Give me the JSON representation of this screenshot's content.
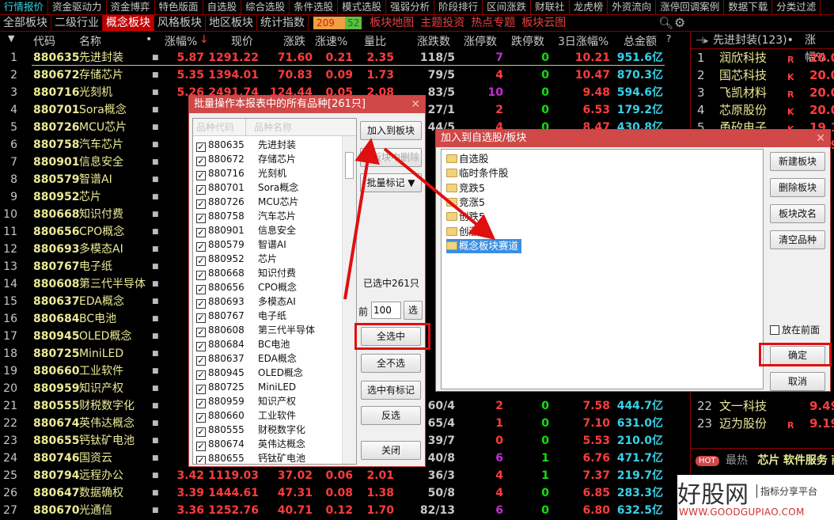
{
  "menu": [
    "行情报价",
    "资金驱动力",
    "资金博弈",
    "特色版面",
    "自选股",
    "综合选股",
    "条件选股",
    "模式选股",
    "强弱分析",
    "阶段排行",
    "区间涨跌",
    "财联社",
    "龙虎榜",
    "外资流向",
    "涨停回调案例",
    "数据下载",
    "分类过滤"
  ],
  "tabs": [
    "全部板块",
    "二级行业",
    "概念板块",
    "风格板块",
    "地区板块",
    "统计指数"
  ],
  "active_tab": "概念板块",
  "counts": {
    "up": "209",
    "down": "52"
  },
  "links": [
    "板块地图",
    "主题投资",
    "热点专题",
    "板块云图"
  ],
  "headers": {
    "arrow": "▼",
    "code": "代码",
    "name": "名称",
    "dot": "•",
    "pct": "涨幅%",
    "sort": "↓",
    "price": "现价",
    "chg": "涨跌",
    "speed": "涨速%",
    "vol": "量比",
    "updown": "涨跌数",
    "limitup": "涨停数",
    "limitdown": "跌停数",
    "pct3": "3日涨幅%",
    "amount": "总金额",
    "q": "?"
  },
  "rows": [
    [
      "1",
      "880635",
      "先进封装",
      "5.87",
      "1291.22",
      "71.60",
      "0.21",
      "2.35",
      "118/5",
      "7",
      "0",
      "10.21",
      "951.6亿"
    ],
    [
      "2",
      "880672",
      "存储芯片",
      "5.35",
      "1394.01",
      "70.83",
      "0.09",
      "1.73",
      "79/5",
      "4",
      "0",
      "10.47",
      "870.3亿"
    ],
    [
      "3",
      "880716",
      "光刻机",
      "5.26",
      "2491.74",
      "124.44",
      "0.05",
      "2.08",
      "83/5",
      "10",
      "0",
      "9.48",
      "594.6亿"
    ],
    [
      "4",
      "880701",
      "Sora概念",
      "",
      "",
      "",
      "",
      "",
      "27/1",
      "2",
      "0",
      "6.53",
      "179.2亿"
    ],
    [
      "5",
      "880726",
      "MCU芯片",
      "",
      "",
      "",
      "",
      "",
      "44/5",
      "4",
      "0",
      "8.47",
      "430.8亿"
    ],
    [
      "6",
      "880758",
      "汽车芯片",
      "",
      "",
      "",
      "",
      "",
      "",
      "",
      "",
      "",
      ""
    ],
    [
      "7",
      "880901",
      "信息安全",
      "",
      "",
      "",
      "",
      "",
      "",
      "",
      "",
      "",
      ""
    ],
    [
      "8",
      "880579",
      "智谱AI",
      "",
      "",
      "",
      "",
      "",
      "",
      "",
      "",
      "",
      ""
    ],
    [
      "9",
      "880952",
      "芯片",
      "",
      "",
      "",
      "",
      "",
      "",
      "",
      "",
      "",
      ""
    ],
    [
      "10",
      "880668",
      "知识付费",
      "",
      "",
      "",
      "",
      "",
      "",
      "",
      "",
      "",
      ""
    ],
    [
      "11",
      "880656",
      "CPO概念",
      "",
      "",
      "",
      "",
      "",
      "",
      "",
      "",
      "",
      ""
    ],
    [
      "12",
      "880693",
      "多模态AI",
      "",
      "",
      "",
      "",
      "",
      "",
      "",
      "",
      "",
      ""
    ],
    [
      "13",
      "880767",
      "电子纸",
      "",
      "",
      "",
      "",
      "",
      "",
      "",
      "",
      "",
      ""
    ],
    [
      "14",
      "880608",
      "第三代半导体",
      "",
      "",
      "",
      "",
      "",
      "",
      "",
      "",
      "",
      ""
    ],
    [
      "15",
      "880637",
      "EDA概念",
      "",
      "",
      "",
      "",
      "",
      "",
      "",
      "",
      "",
      ""
    ],
    [
      "16",
      "880684",
      "BC电池",
      "",
      "",
      "",
      "",
      "",
      "",
      "",
      "",
      "",
      ""
    ],
    [
      "17",
      "880945",
      "OLED概念",
      "",
      "",
      "",
      "",
      "",
      "",
      "",
      "",
      "",
      ""
    ],
    [
      "18",
      "880725",
      "MiniLED",
      "",
      "",
      "",
      "",
      "",
      "",
      "",
      "",
      "",
      ""
    ],
    [
      "19",
      "880660",
      "工业软件",
      "",
      "",
      "",
      "",
      "",
      "",
      "",
      "",
      "",
      ""
    ],
    [
      "20",
      "880959",
      "知识产权",
      "",
      "",
      "",
      "",
      "",
      "",
      "",
      "",
      "",
      ""
    ],
    [
      "21",
      "880555",
      "财税数字化",
      "",
      "",
      "",
      "",
      "",
      "60/4",
      "2",
      "0",
      "7.58",
      "444.7亿"
    ],
    [
      "22",
      "880674",
      "英伟达概念",
      "",
      "",
      "",
      "",
      "",
      "65/4",
      "1",
      "0",
      "7.10",
      "631.0亿"
    ],
    [
      "23",
      "880655",
      "钙钛矿电池",
      "",
      "",
      "",
      "",
      "",
      "39/7",
      "0",
      "0",
      "5.53",
      "210.0亿"
    ],
    [
      "24",
      "880746",
      "国资云",
      "",
      "",
      "",
      "",
      "",
      "40/8",
      "6",
      "1",
      "6.76",
      "471.7亿"
    ],
    [
      "25",
      "880794",
      "远程办公",
      "3.42",
      "1119.03",
      "37.02",
      "0.06",
      "2.01",
      "36/3",
      "4",
      "1",
      "7.37",
      "219.7亿"
    ],
    [
      "26",
      "880647",
      "数据确权",
      "3.39",
      "1444.61",
      "47.31",
      "0.08",
      "1.38",
      "50/8",
      "4",
      "0",
      "6.85",
      "283.3亿"
    ],
    [
      "27",
      "880670",
      "光通信",
      "3.36",
      "1252.76",
      "40.71",
      "0.12",
      "1.70",
      "82/13",
      "6",
      "0",
      "6.80",
      "632.5亿"
    ]
  ],
  "right_panel": {
    "title": "先进封装(123)•",
    "col": "涨幅%",
    "items": [
      [
        "1",
        "润欣科技",
        "R",
        "20.01"
      ],
      [
        "2",
        "国芯科技",
        "K",
        "20.01"
      ],
      [
        "3",
        "飞凯材料",
        "R",
        "20.00"
      ],
      [
        "4",
        "芯原股份",
        "K",
        "20.00"
      ],
      [
        "5",
        "甬矽电子",
        "K",
        "19.12"
      ],
      [
        "6",
        "晶圆斯特",
        "",
        "18.97"
      ]
    ],
    "items_bottom": [
      [
        "22",
        "文一科技",
        "",
        "9.49"
      ],
      [
        "23",
        "迈为股份",
        "R",
        "9.19"
      ]
    ],
    "hot": {
      "badge": "HOT",
      "label": "最热",
      "tags": [
        "芯片",
        "软件服务",
        "商"
      ]
    }
  },
  "dialog1": {
    "title": "批量操作本报表中的所有品种[261只]",
    "col_code": "品种代码",
    "col_name": "品种名称",
    "items": [
      [
        "880635",
        "先进封装"
      ],
      [
        "880672",
        "存储芯片"
      ],
      [
        "880716",
        "光刻机"
      ],
      [
        "880701",
        "Sora概念"
      ],
      [
        "880726",
        "MCU芯片"
      ],
      [
        "880758",
        "汽车芯片"
      ],
      [
        "880901",
        "信息安全"
      ],
      [
        "880579",
        "智谱AI"
      ],
      [
        "880952",
        "芯片"
      ],
      [
        "880668",
        "知识付费"
      ],
      [
        "880656",
        "CPO概念"
      ],
      [
        "880693",
        "多模态AI"
      ],
      [
        "880767",
        "电子纸"
      ],
      [
        "880608",
        "第三代半导体"
      ],
      [
        "880684",
        "BC电池"
      ],
      [
        "880637",
        "EDA概念"
      ],
      [
        "880945",
        "OLED概念"
      ],
      [
        "880725",
        "MiniLED"
      ],
      [
        "880959",
        "知识产权"
      ],
      [
        "880660",
        "工业软件"
      ],
      [
        "880555",
        "财税数字化"
      ],
      [
        "880674",
        "英伟达概念"
      ],
      [
        "880655",
        "钙钛矿电池"
      ]
    ],
    "buttons": {
      "add": "加入到板块",
      "remove": "从板块中删除",
      "mark": "批量标记 ▼",
      "select_all": "全选中",
      "select_none": "全不选",
      "select_marked": "选中有标记",
      "invert": "反选",
      "close": "关闭",
      "select": "选"
    },
    "selected": "已选中261只",
    "front_label": "前",
    "front_value": "100"
  },
  "dialog2": {
    "title": "加入到自选股/板块",
    "folders": [
      "自选股",
      "临时条件股",
      "竞跌5",
      "竞涨5",
      "创跌5",
      "创涨5",
      "概念板块赛道"
    ],
    "selected": "概念板块赛道",
    "buttons": {
      "new": "新建板块",
      "delete": "删除板块",
      "rename": "板块改名",
      "clear": "清空品种",
      "ok": "确定",
      "cancel": "取消"
    },
    "put_front": "放在前面",
    "put_front_checked": false
  },
  "watermark": {
    "logo": "好股网",
    "slogan": "指标分享平台",
    "url": "WWW.GOODGUPIAO.COM"
  },
  "colors": {
    "up": "#ff3c3c",
    "down": "#10e010",
    "limit": "#c030d0",
    "amount": "#36d0e6",
    "code": "#eaea98",
    "dialog_title": "#d04848",
    "highlight": "#e01010"
  }
}
